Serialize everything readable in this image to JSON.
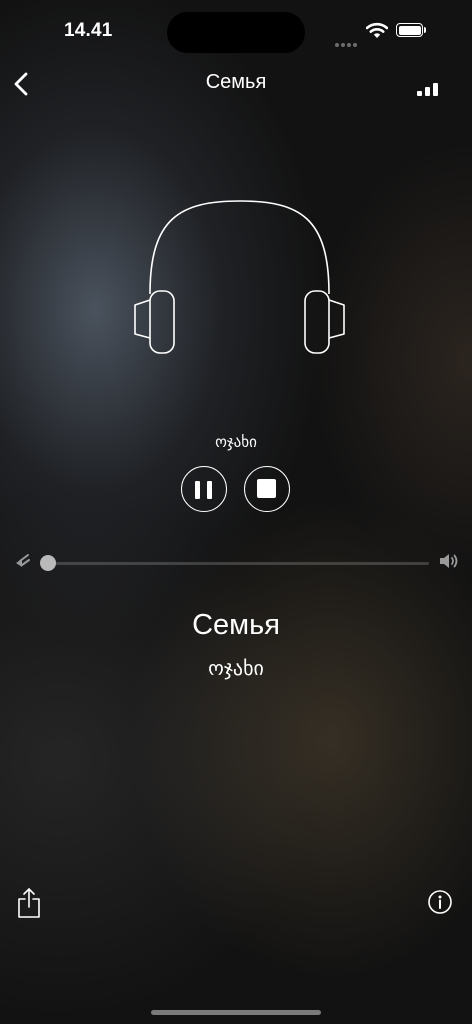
{
  "status_bar": {
    "time": "14.41",
    "icons": [
      "cellular-dots-icon",
      "wifi-icon",
      "battery-icon"
    ]
  },
  "nav": {
    "back_icon": "chevron-left-icon",
    "title": "Семья",
    "right_icon": "signal-bars-icon"
  },
  "player": {
    "artwork_icon": "headphones-icon",
    "word": "ოჯახი",
    "pause_icon": "pause-icon",
    "stop_icon": "stop-icon",
    "speed_icon": "slow-speed-icon",
    "volume_icon": "speaker-icon",
    "slider_value": 0
  },
  "phrase": {
    "title": "Семья",
    "translation": "ოჯახი"
  },
  "bottom": {
    "share_icon": "share-icon",
    "info_icon": "info-icon"
  },
  "colors": {
    "foreground": "#ffffff",
    "background": "#121212",
    "thumb": "#b9b9b9"
  }
}
